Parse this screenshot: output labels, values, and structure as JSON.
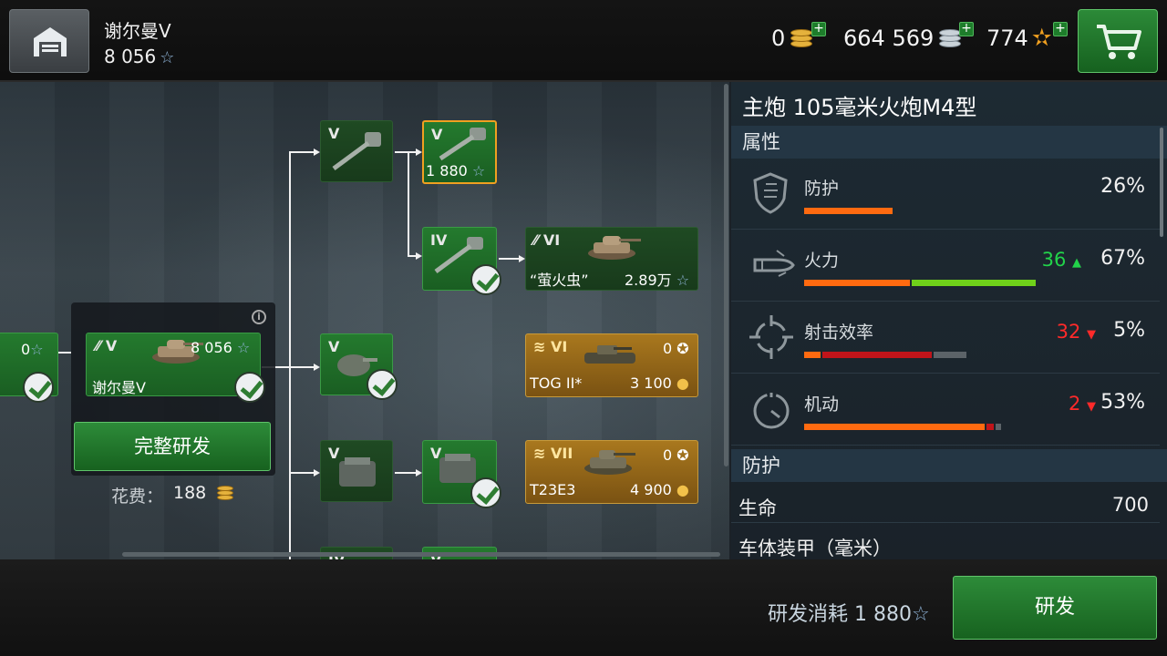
{
  "header": {
    "vehicle_name": "谢尔曼V",
    "vehicle_xp": "8 056",
    "gold": "0",
    "silver": "664 569",
    "free_xp": "774"
  },
  "tree": {
    "prev_xp": "0",
    "current": {
      "tier": "V",
      "name": "谢尔曼V",
      "xp": "8 056"
    },
    "gun_top": {
      "tier": "V"
    },
    "gun_selected": {
      "tier": "V",
      "cost": "1 880"
    },
    "gun_iv": {
      "tier": "IV"
    },
    "firefly": {
      "tier": "VI",
      "name": "“萤火虫”",
      "cost": "2.89万"
    },
    "turret": {
      "tier": "V"
    },
    "tog": {
      "tier": "VI",
      "name": "TOG II*",
      "xp": "0",
      "price": "3 100"
    },
    "engine1": {
      "tier": "V"
    },
    "engine2": {
      "tier": "V"
    },
    "t23": {
      "tier": "VII",
      "name": "T23E3",
      "xp": "0",
      "price": "4 900"
    },
    "bottom_partial_1": "IV",
    "bottom_partial_2": "V",
    "full_research_label": "完整研发",
    "cost_label": "花费：",
    "cost_value": "188"
  },
  "details": {
    "title": "主炮 105毫米火炮M4型",
    "section_attributes": "属性",
    "stats": [
      {
        "label": "防护",
        "value": "26%",
        "delta": "",
        "fraction": 0.26
      },
      {
        "label": "火力",
        "value": "67%",
        "delta": "36",
        "delta_dir": "up",
        "fraction": 0.67
      },
      {
        "label": "射击效率",
        "value": "5%",
        "delta": "32",
        "delta_dir": "down",
        "fraction": 0.05
      },
      {
        "label": "机动",
        "value": "53%",
        "delta": "2",
        "delta_dir": "down",
        "fraction": 0.53
      }
    ],
    "section_protection": "防护",
    "props": [
      {
        "label": "生命",
        "value": "700"
      },
      {
        "label": "车体装甲（毫米）",
        "value": ""
      }
    ]
  },
  "footer": {
    "research_cost_label": "研发消耗 1 880",
    "research_button": "研发"
  },
  "colors": {
    "accent_green": "#2d8b39",
    "selected_border": "#f0a020",
    "bar_orange": "#ff6a10",
    "bar_green": "#6fd11a",
    "bar_red": "#c0141a",
    "delta_up": "#22d34a",
    "delta_down": "#ff2a2a"
  }
}
